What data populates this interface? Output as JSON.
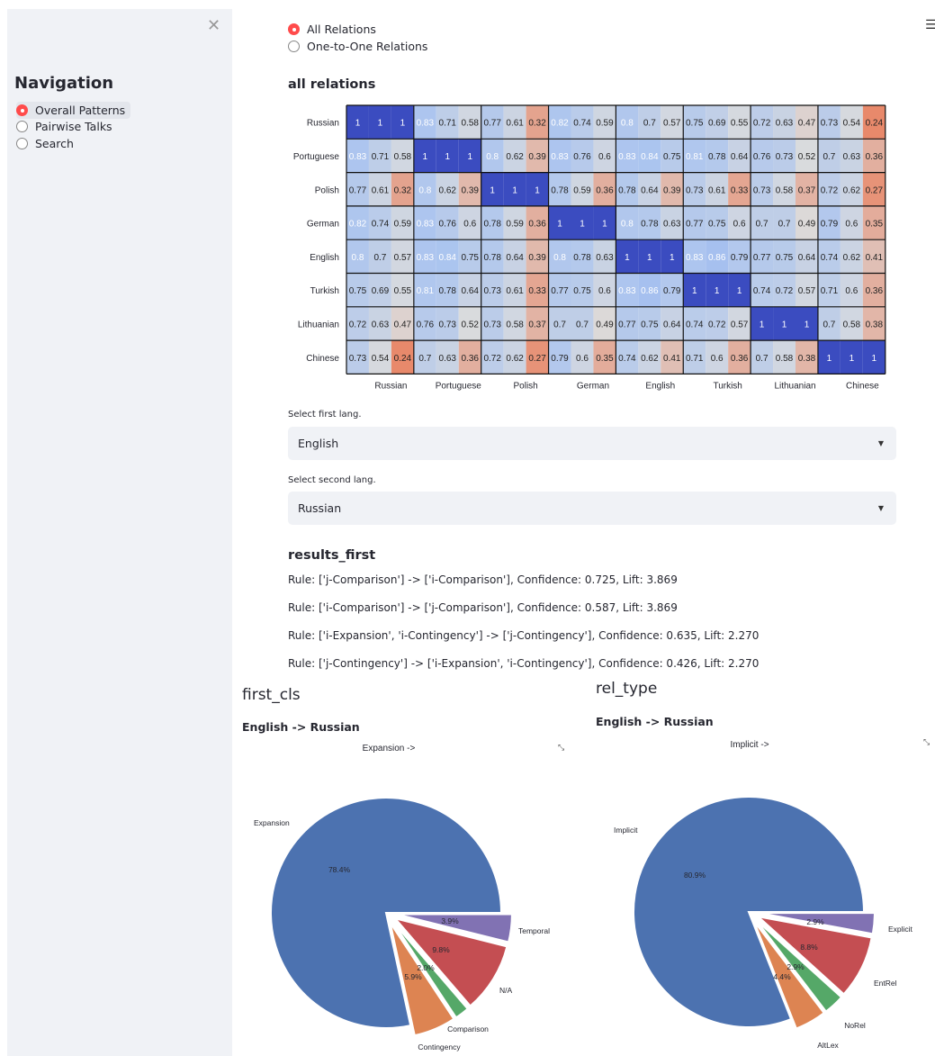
{
  "sidebar": {
    "title": "Navigation",
    "items": [
      {
        "label": "Overall Patterns",
        "selected": true
      },
      {
        "label": "Pairwise Talks",
        "selected": false
      },
      {
        "label": "Search",
        "selected": false
      }
    ]
  },
  "relation_mode": {
    "options": [
      {
        "label": "All Relations",
        "selected": true
      },
      {
        "label": "One-to-One Relations",
        "selected": false
      }
    ]
  },
  "heatmap_section": {
    "title": "all relations"
  },
  "chart_data": [
    {
      "type": "heatmap",
      "title": "all relations",
      "row_labels": [
        "Russian",
        "Portuguese",
        "Polish",
        "German",
        "English",
        "Turkish",
        "Lithuanian",
        "Chinese"
      ],
      "col_group_labels": [
        "Russian",
        "Portuguese",
        "Polish",
        "German",
        "English",
        "Turkish",
        "Lithuanian",
        "Chinese"
      ],
      "values": [
        [
          "1",
          "1",
          "1",
          "0.83",
          "0.71",
          "0.58",
          "0.77",
          "0.61",
          "0.32",
          "0.82",
          "0.74",
          "0.59",
          "0.8",
          "0.7",
          "0.57",
          "0.75",
          "0.69",
          "0.55",
          "0.72",
          "0.63",
          "0.47",
          "0.73",
          "0.54",
          "0.24"
        ],
        [
          "0.83",
          "0.71",
          "0.58",
          "1",
          "1",
          "1",
          "0.8",
          "0.62",
          "0.39",
          "0.83",
          "0.76",
          "0.6",
          "0.83",
          "0.84",
          "0.75",
          "0.81",
          "0.78",
          "0.64",
          "0.76",
          "0.73",
          "0.52",
          "0.7",
          "0.63",
          "0.36"
        ],
        [
          "0.77",
          "0.61",
          "0.32",
          "0.8",
          "0.62",
          "0.39",
          "1",
          "1",
          "1",
          "0.78",
          "0.59",
          "0.36",
          "0.78",
          "0.64",
          "0.39",
          "0.73",
          "0.61",
          "0.33",
          "0.73",
          "0.58",
          "0.37",
          "0.72",
          "0.62",
          "0.27"
        ],
        [
          "0.82",
          "0.74",
          "0.59",
          "0.83",
          "0.76",
          "0.6",
          "0.78",
          "0.59",
          "0.36",
          "1",
          "1",
          "1",
          "0.8",
          "0.78",
          "0.63",
          "0.77",
          "0.75",
          "0.6",
          "0.7",
          "0.7",
          "0.49",
          "0.79",
          "0.6",
          "0.35"
        ],
        [
          "0.8",
          "0.7",
          "0.57",
          "0.83",
          "0.84",
          "0.75",
          "0.78",
          "0.64",
          "0.39",
          "0.8",
          "0.78",
          "0.63",
          "1",
          "1",
          "1",
          "0.83",
          "0.86",
          "0.79",
          "0.77",
          "0.75",
          "0.64",
          "0.74",
          "0.62",
          "0.41"
        ],
        [
          "0.75",
          "0.69",
          "0.55",
          "0.81",
          "0.78",
          "0.64",
          "0.73",
          "0.61",
          "0.33",
          "0.77",
          "0.75",
          "0.6",
          "0.83",
          "0.86",
          "0.79",
          "1",
          "1",
          "1",
          "0.74",
          "0.72",
          "0.57",
          "0.71",
          "0.6",
          "0.36"
        ],
        [
          "0.72",
          "0.63",
          "0.47",
          "0.76",
          "0.73",
          "0.52",
          "0.73",
          "0.58",
          "0.37",
          "0.7",
          "0.7",
          "0.49",
          "0.77",
          "0.75",
          "0.64",
          "0.74",
          "0.72",
          "0.57",
          "1",
          "1",
          "1",
          "0.7",
          "0.58",
          "0.38"
        ],
        [
          "0.73",
          "0.54",
          "0.24",
          "0.7",
          "0.63",
          "0.36",
          "0.72",
          "0.62",
          "0.27",
          "0.79",
          "0.6",
          "0.35",
          "0.74",
          "0.62",
          "0.41",
          "0.71",
          "0.6",
          "0.36",
          "0.7",
          "0.58",
          "0.38",
          "1",
          "1",
          "1"
        ]
      ],
      "colormap": {
        "low": "#e8896b",
        "mid": "#dcdcdc",
        "high": "#3b4cc0"
      }
    },
    {
      "type": "pie",
      "title": "Expansion ->",
      "labels": [
        "Expansion",
        "Contingency",
        "Comparison",
        "N/A",
        "Temporal"
      ],
      "pct_labels": [
        "78.4%",
        "5.9%",
        "2.0%",
        "9.8%",
        "3.9%"
      ],
      "values": [
        78.4,
        5.9,
        2.0,
        9.8,
        3.9
      ],
      "colors": [
        "#4c72b0",
        "#dd8452",
        "#55a868",
        "#c44e52",
        "#8172b3"
      ]
    },
    {
      "type": "pie",
      "title": "Implicit ->",
      "labels": [
        "Implicit",
        "AltLex",
        "NoRel",
        "EntRel",
        "Explicit"
      ],
      "pct_labels": [
        "80.9%",
        "4.4%",
        "2.9%",
        "8.8%",
        "2.9%"
      ],
      "values": [
        80.9,
        4.4,
        2.9,
        8.8,
        2.9
      ],
      "colors": [
        "#4c72b0",
        "#dd8452",
        "#55a868",
        "#c44e52",
        "#8172b3"
      ]
    }
  ],
  "first_lang": {
    "label": "Select first lang.",
    "value": "English"
  },
  "second_lang": {
    "label": "Select second lang.",
    "value": "Russian"
  },
  "results": {
    "title": "results_first",
    "rules": [
      "Rule: ['j-Comparison'] -> ['i-Comparison'], Confidence: 0.725, Lift: 3.869",
      "Rule: ['i-Comparison'] -> ['j-Comparison'], Confidence: 0.587, Lift: 3.869",
      "Rule: ['i-Expansion', 'i-Contingency'] -> ['j-Contingency'], Confidence: 0.635, Lift: 2.270",
      "Rule: ['j-Contingency'] -> ['i-Expansion', 'i-Contingency'], Confidence: 0.426, Lift: 2.270"
    ]
  },
  "pie_left": {
    "section_title": "first_cls",
    "subtitle": "English -> Russian"
  },
  "pie_right": {
    "section_title": "rel_type",
    "subtitle": "English -> Russian"
  }
}
